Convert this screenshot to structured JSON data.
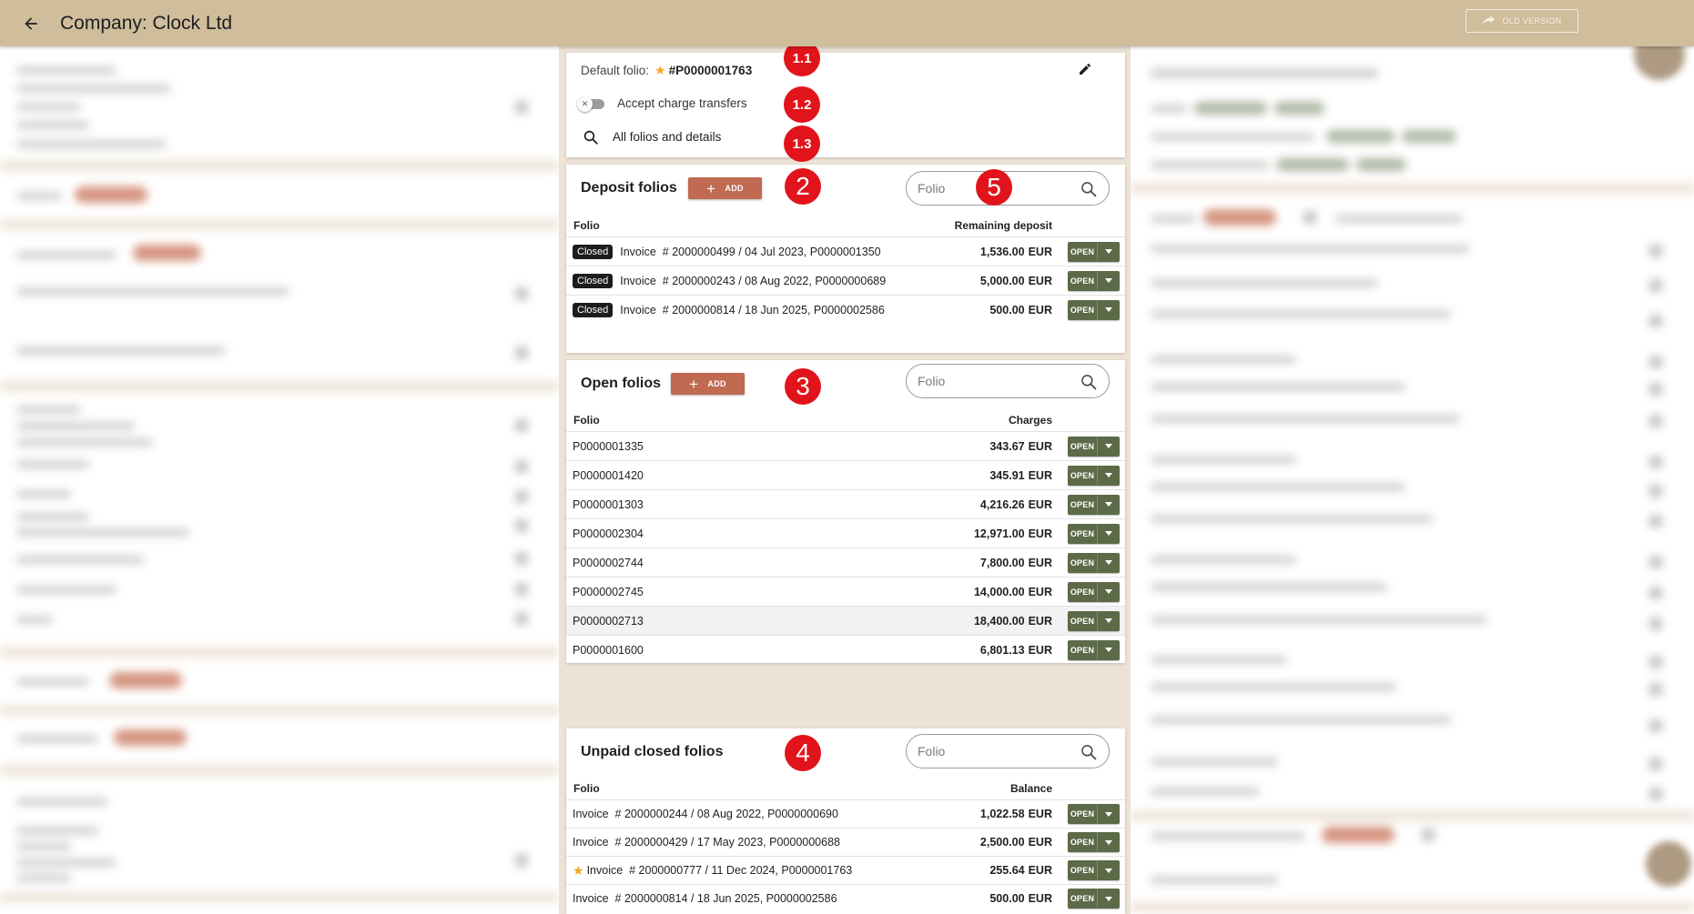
{
  "header": {
    "title": "Company: Clock Ltd",
    "old_version_label": "OLD VERSION"
  },
  "summary": {
    "default_folio_label": "Default folio:",
    "default_folio_value": "#P0000001763",
    "accept_charge_transfers_label": "Accept charge transfers",
    "accept_charge_transfers_on": false,
    "all_folios_label": "All folios and details"
  },
  "deposit": {
    "title": "Deposit folios",
    "add_label": "ADD",
    "search_placeholder": "Folio",
    "col_folio": "Folio",
    "col_amount": "Remaining deposit",
    "rows": [
      {
        "status": "Closed",
        "text": "Invoice  # 2000000499 / 04 Jul 2023, P0000001350",
        "amount": "1,536.00",
        "currency": "EUR"
      },
      {
        "status": "Closed",
        "text": "Invoice  # 2000000243 / 08 Aug 2022, P0000000689",
        "amount": "5,000.00",
        "currency": "EUR"
      },
      {
        "status": "Closed",
        "text": "Invoice  # 2000000814 / 18 Jun 2025, P0000002586",
        "amount": "500.00",
        "currency": "EUR"
      }
    ]
  },
  "open": {
    "title": "Open folios",
    "add_label": "ADD",
    "search_placeholder": "Folio",
    "col_folio": "Folio",
    "col_amount": "Charges",
    "rows": [
      {
        "text": "P0000001335",
        "amount": "343.67",
        "currency": "EUR"
      },
      {
        "text": "P0000001420",
        "amount": "345.91",
        "currency": "EUR"
      },
      {
        "text": "P0000001303",
        "amount": "4,216.26",
        "currency": "EUR"
      },
      {
        "text": "P0000002304",
        "amount": "12,971.00",
        "currency": "EUR"
      },
      {
        "text": "P0000002744",
        "amount": "7,800.00",
        "currency": "EUR"
      },
      {
        "text": "P0000002745",
        "amount": "14,000.00",
        "currency": "EUR"
      },
      {
        "text": "P0000002713",
        "amount": "18,400.00",
        "currency": "EUR"
      },
      {
        "text": "P0000001600",
        "amount": "6,801.13",
        "currency": "EUR"
      }
    ]
  },
  "unpaid": {
    "title": "Unpaid closed folios",
    "search_placeholder": "Folio",
    "col_folio": "Folio",
    "col_amount": "Balance",
    "rows": [
      {
        "text": "Invoice  # 2000000244 / 08 Aug 2022, P0000000690",
        "amount": "1,022.58",
        "currency": "EUR",
        "starred": false
      },
      {
        "text": "Invoice  # 2000000429 / 17 May 2023, P0000000688",
        "amount": "2,500.00",
        "currency": "EUR",
        "starred": false
      },
      {
        "text": "Invoice  # 2000000777 / 11 Dec 2024, P0000001763",
        "amount": "255.64",
        "currency": "EUR",
        "starred": true
      },
      {
        "text": "Invoice  # 2000000814 / 18 Jun 2025, P0000002586",
        "amount": "500.00",
        "currency": "EUR",
        "starred": false
      }
    ]
  },
  "row_actions": {
    "open_label": "OPEN"
  },
  "markers": {
    "m11": "1.1",
    "m12": "1.2",
    "m13": "1.3",
    "m2": "2",
    "m3": "3",
    "m4": "4",
    "m5": "5"
  },
  "colors": {
    "header": "#cfbd9c",
    "add_button": "#bf6a51",
    "open_button": "#5c6a48",
    "marker": "#e2141b",
    "star": "#f5a623"
  }
}
